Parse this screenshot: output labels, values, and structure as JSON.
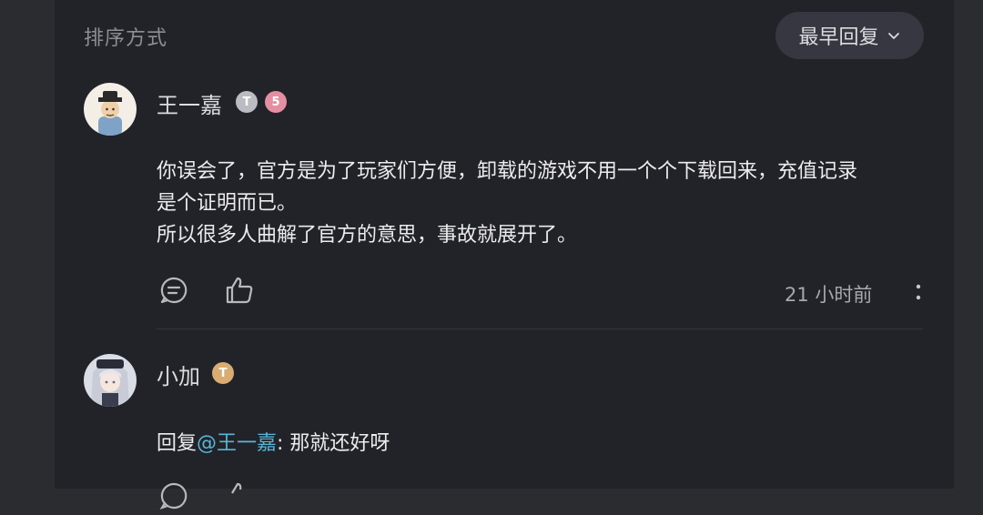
{
  "sort": {
    "label": "排序方式",
    "current": "最早回复"
  },
  "comments": [
    {
      "name": "王一嘉",
      "badges": [
        "T",
        "5"
      ],
      "lines": [
        "你误会了，官方是为了玩家们方便，卸载的游戏不用一个个下载回来，充值记录",
        "是个证明而已。",
        "所以很多人曲解了官方的意思，事故就展开了。"
      ],
      "time": "21 小时前"
    },
    {
      "name": "小加",
      "badges": [
        "T"
      ],
      "reply_prefix": "回复",
      "mention": "@王一嘉",
      "reply_text": ": 那就还好呀"
    }
  ],
  "colors": {
    "background": "#222328",
    "mention": "#57b5d6",
    "badge_silver": "#b9bcc3",
    "badge_pink": "#e58fa3",
    "badge_gold": "#d9ad72"
  }
}
